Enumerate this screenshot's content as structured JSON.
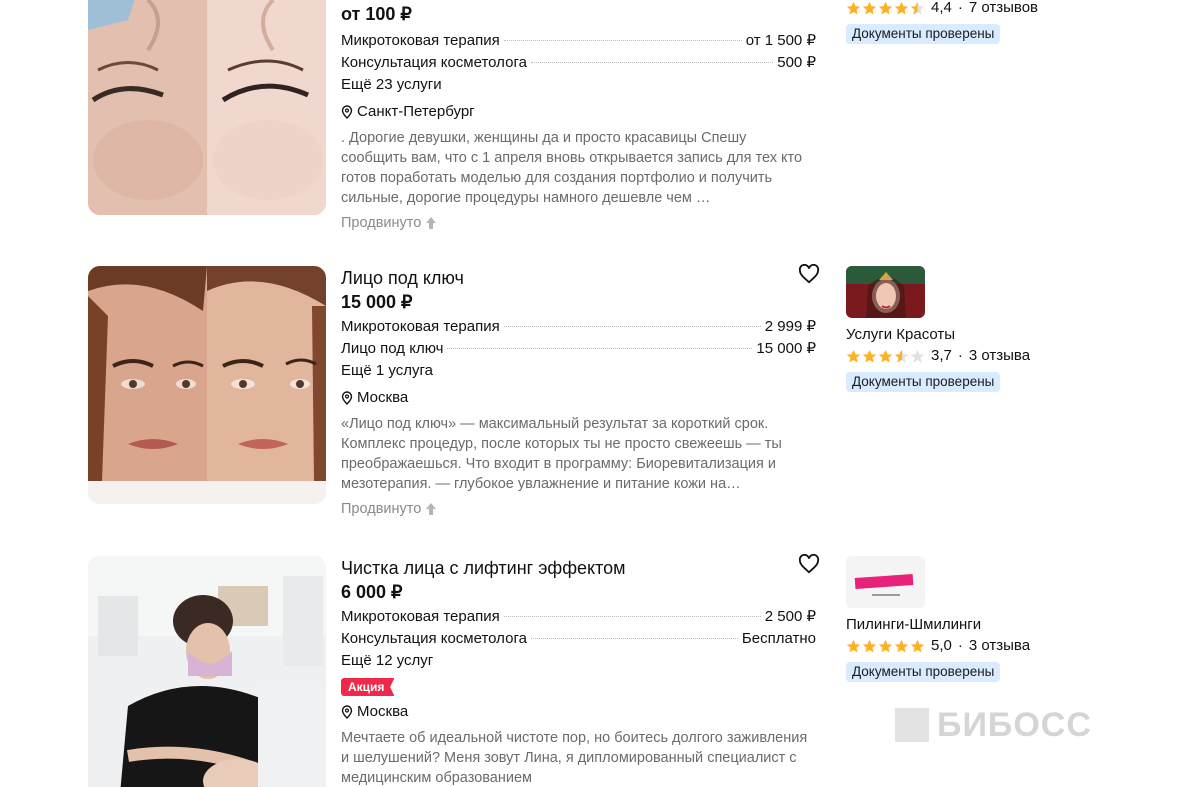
{
  "listings": [
    {
      "title": "",
      "price": "от 100 ₽",
      "services": [
        {
          "name": "Микротоковая терапия",
          "price": "от 1 500 ₽"
        },
        {
          "name": "Консультация косметолога",
          "price": "500 ₽"
        }
      ],
      "more": "Ещё 23 услуги",
      "location": "Санкт-Петербург",
      "description": ". Дорогие девушки, женщины да и просто красавицы Спешу сообщить вам, что с 1 апреля вновь открывается запись для тех кто готов поработать моделью для создания портфолио и получить сильные, дорогие процедуры намного дешевле чем …",
      "promoted": "Продвинуто",
      "seller": {
        "name": "",
        "rating": "4,4",
        "reviews": "7 отзывов",
        "verified": "Документы проверены"
      }
    },
    {
      "title": "Лицо под ключ",
      "price": "15 000 ₽",
      "services": [
        {
          "name": "Микротоковая терапия",
          "price": "2 999 ₽"
        },
        {
          "name": "Лицо под ключ",
          "price": "15 000 ₽"
        }
      ],
      "more": "Ещё 1 услуга",
      "location": "Москва",
      "description": "«Лицо под ключ» — максимальный результат за короткий срок. Комплекс процедур, после которых ты не просто свежеешь — ты преображаешься. Что входит в программу: Биоревитализация и мезотерапия. — глубокое увлажнение и питание кожи на…",
      "promoted": "Продвинуто",
      "seller": {
        "name": "Услуги Красоты",
        "rating": "3,7",
        "reviews": "3 отзыва",
        "verified": "Документы проверены"
      }
    },
    {
      "title": "Чистка лица с лифтинг эффектом",
      "price": "6 000 ₽",
      "services": [
        {
          "name": "Микротоковая терапия",
          "price": "2 500 ₽"
        },
        {
          "name": "Консультация косметолога",
          "price": "Бесплатно"
        }
      ],
      "more": "Ещё 12 услуг",
      "badge": "Акция",
      "location": "Москва",
      "description": "Мечтаете об идеальной чистоте пор, но боитесь долгого заживления и шелушений? Меня зовут Лина, я дипломированный специалист с медицинским образованием",
      "seller": {
        "name": "Пилинги-Шмилинги",
        "rating": "5,0",
        "reviews": "3 отзыва",
        "verified": "Документы проверены"
      }
    }
  ],
  "watermark": "БИБОСС",
  "colors": {
    "sale": "#f0294a",
    "verified_bg": "#d9ecff",
    "star": "#ffb021",
    "text_muted": "#6b6b6b"
  },
  "icons": [
    "heart-icon",
    "location-pin-icon",
    "arrow-up-icon",
    "star-icon"
  ]
}
